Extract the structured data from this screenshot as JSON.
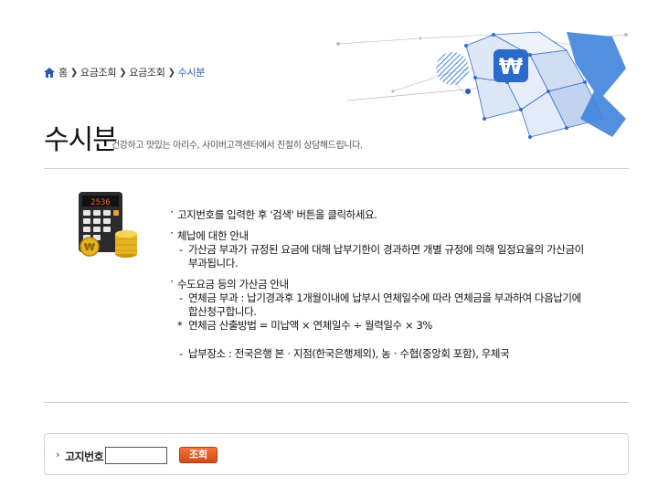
{
  "breadcrumb": {
    "items": [
      "홈",
      "요금조회",
      "요금조회",
      "수시분"
    ]
  },
  "page": {
    "title": "수시분",
    "subtitle": "건강하고 맛있는 아리수, 사이버고객센터에서 친절히 상담해드립니다."
  },
  "hero": {
    "currency_symbol": "₩"
  },
  "illustration": {
    "display_value": "2536"
  },
  "notice": {
    "section1": {
      "text": "고지번호를 입력한 후 '검색' 버튼을 클릭하세요."
    },
    "section2": {
      "title": "체납에 대한 안내",
      "line1": "가산금 부과가 규정된 요금에 대해 납부기한이 경과하면 개별 규정에 의해 일정요율의 가산금이",
      "line2": "부과됩니다."
    },
    "section3": {
      "title": "수도요금 등의 가산금 안내",
      "line1": "연체금 부과 : 납기경과후 1개월이내에 납부시 연체일수에 따라 연체금을 부과하여 다음납기에",
      "line2": "합산청구합니다.",
      "formula_mark": "*",
      "formula": "연체금 산출방법 = 미납액 × 연체일수 ÷ 월력일수 × 3%",
      "payment_places": "납부장소 : 전국은행 본ㆍ지점(한국은행제외), 농ㆍ수협(중앙회 포함), 우체국"
    }
  },
  "search": {
    "label": "고지번호",
    "input_value": "",
    "button_label": "조회"
  },
  "colors": {
    "accent_blue": "#2a58b8",
    "button_orange": "#e05a25",
    "graphic_blue": "#3f84dc"
  }
}
